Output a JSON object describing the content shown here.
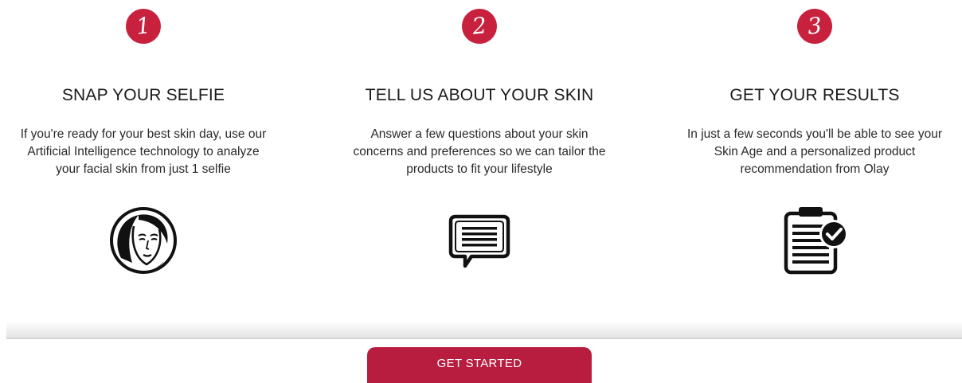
{
  "theme": {
    "accent": "#c8213d",
    "button": "#b81c3e"
  },
  "steps": [
    {
      "number": "1",
      "title": "SNAP YOUR SELFIE",
      "description_lines": [
        "If you're ready for your best skin day, use our",
        "Artificial Intelligence technology to analyze",
        "your facial skin from just 1 selfie"
      ],
      "icon": "face-icon"
    },
    {
      "number": "2",
      "title": "TELL US ABOUT YOUR SKIN",
      "description_lines": [
        "Answer a few questions about your skin",
        "concerns and preferences so we can tailor the",
        "products to fit your lifestyle"
      ],
      "icon": "chat-bubble-icon"
    },
    {
      "number": "3",
      "title": "GET YOUR RESULTS",
      "description_lines": [
        "In just a few seconds you'll be able to see your",
        "Skin Age and a personalized product",
        "recommendation from Olay"
      ],
      "icon": "clipboard-check-icon"
    }
  ],
  "cta": {
    "label": "GET STARTED"
  }
}
